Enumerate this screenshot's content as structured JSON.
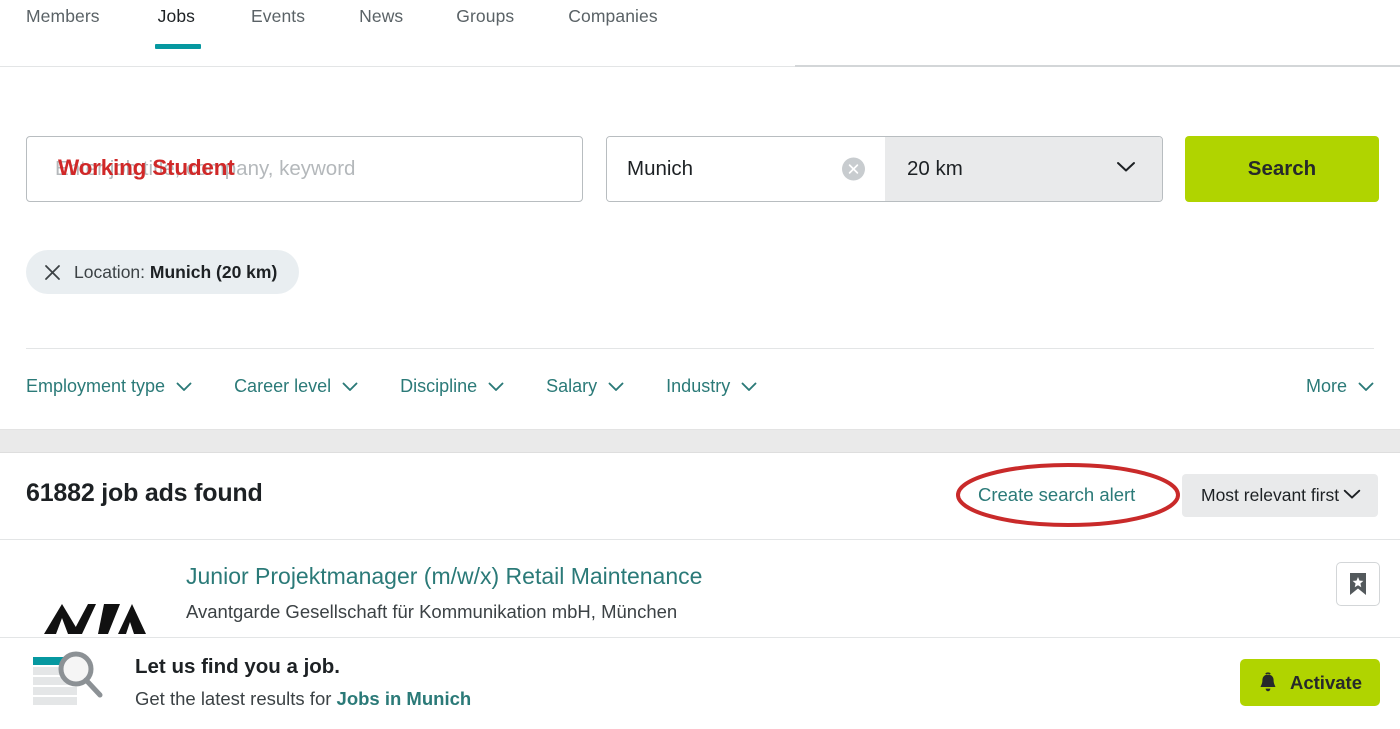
{
  "nav": {
    "tabs": [
      {
        "label": "Members",
        "active": false
      },
      {
        "label": "Jobs",
        "active": true
      },
      {
        "label": "Events",
        "active": false
      },
      {
        "label": "News",
        "active": false
      },
      {
        "label": "Groups",
        "active": false
      },
      {
        "label": "Companies",
        "active": false
      }
    ]
  },
  "search": {
    "keyword_placeholder": "Enter job title, company, keyword",
    "keyword_annotation": "Working Student",
    "location_value": "Munich",
    "distance_value": "20 km",
    "search_label": "Search"
  },
  "chip": {
    "prefix": "Location",
    "value": "Munich (20 km)"
  },
  "filters": {
    "items": [
      {
        "label": "Employment type"
      },
      {
        "label": "Career level"
      },
      {
        "label": "Discipline"
      },
      {
        "label": "Salary"
      },
      {
        "label": "Industry"
      }
    ],
    "more_label": "More"
  },
  "results": {
    "count_label": "61882 job ads found",
    "create_alert_label": "Create search alert",
    "sort_value": "Most relevant first"
  },
  "jobs": [
    {
      "title": "Junior Projektmanager (m/w/x) Retail Maintenance",
      "company": "Avantgarde Gesellschaft für Kommunikation mbH, München"
    }
  ],
  "banner": {
    "title": "Let us find you a job.",
    "subtitle_prefix": "Get the latest results for ",
    "subtitle_link": "Jobs in Munich",
    "activate_label": "Activate"
  },
  "colors": {
    "accent_teal": "#2b7a78",
    "tab_underline": "#0698a0",
    "brand_green": "#b0d400",
    "annotation_red": "#c92a2a",
    "chip_bg": "#e9eef1",
    "band_gray": "#eaeaea"
  }
}
